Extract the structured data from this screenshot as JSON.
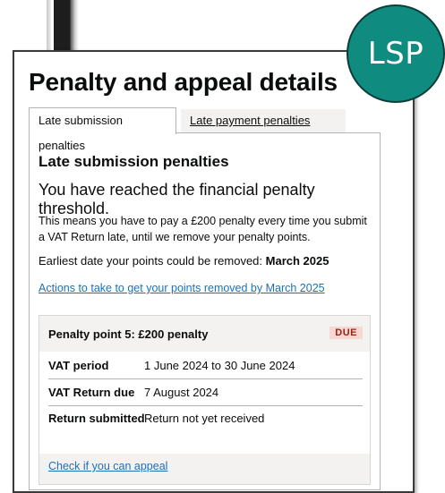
{
  "badge": "LSP",
  "page_title": "Penalty and appeal details",
  "tabs": [
    {
      "label": "Late submission penalties",
      "active": true
    },
    {
      "label": "Late payment penalties",
      "active": false
    }
  ],
  "panel": {
    "heading": "Late submission penalties",
    "lead": "You have reached the financial penalty threshold.",
    "body": "This means you have to pay a £200 penalty every time you submit a VAT Return late, until we remove your penalty points.",
    "earliest_label": "Earliest date your points could be removed:",
    "earliest_value": "March 2025",
    "actions_link": "Actions to take to get your points removed by March 2025"
  },
  "penalty": {
    "title": "Penalty point 5: £200 penalty",
    "status": "DUE",
    "rows": [
      {
        "key": "VAT period",
        "value": "1 June 2024 to 30 June 2024"
      },
      {
        "key": "VAT Return due",
        "value": "7 August 2024"
      },
      {
        "key": "Return submitted",
        "value": "Return not yet received"
      }
    ],
    "appeal_link": "Check if you can appeal"
  },
  "colors": {
    "badge": "#0f8b80",
    "link": "#1d70b8",
    "due_bg": "#f6d7d2",
    "due_text": "#942514"
  }
}
